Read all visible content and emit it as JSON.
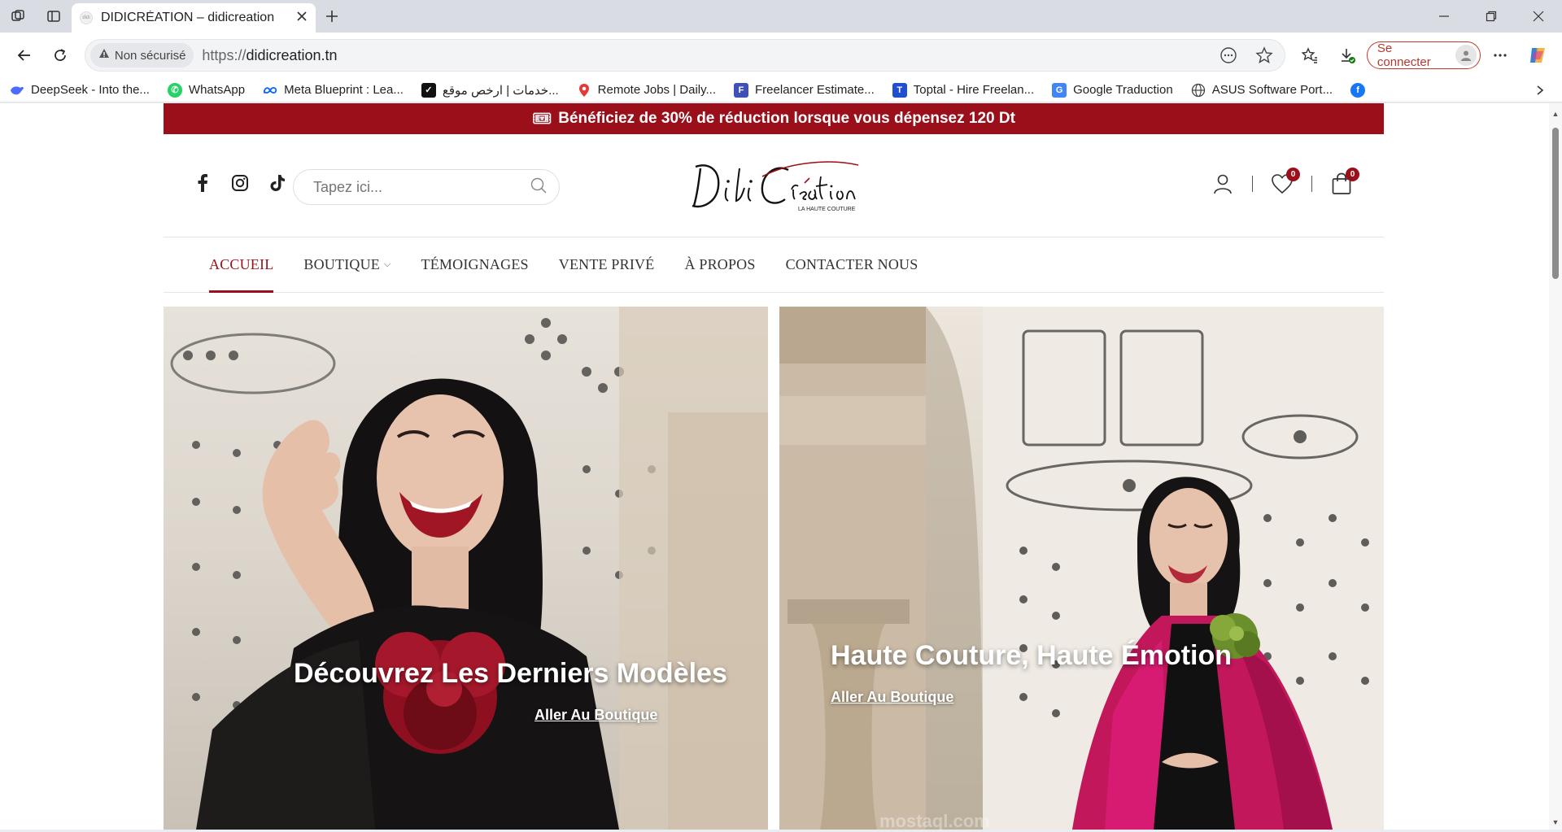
{
  "browser": {
    "tab_title": "DIDICRÉATION – didicreation",
    "favicon_text": "didi",
    "security_label": "Non sécurisé",
    "url_scheme": "https://",
    "url_host": "didicreation.tn",
    "signin_label": "Se connecter",
    "bookmarks": [
      {
        "label": "DeepSeek - Into the...",
        "icon": "deepseek-icon",
        "color": "#4d6bfe"
      },
      {
        "label": "WhatsApp",
        "icon": "whatsapp-icon",
        "color": "#25d366"
      },
      {
        "label": "Meta Blueprint : Lea...",
        "icon": "meta-icon",
        "color": "#0866ff"
      },
      {
        "label": "خدمات | ارخص موقع...",
        "icon": "khamsat-icon",
        "color": "#111111"
      },
      {
        "label": "Remote Jobs | Daily...",
        "icon": "location-pin-icon",
        "color": "#e53935"
      },
      {
        "label": "Freelancer Estimate...",
        "icon": "freelancer-icon",
        "color": "#3f51b5"
      },
      {
        "label": "Toptal - Hire Freelan...",
        "icon": "toptal-icon",
        "color": "#204ecf"
      },
      {
        "label": "Google Traduction",
        "icon": "google-translate-icon",
        "color": "#4285f4"
      },
      {
        "label": "ASUS Software Port...",
        "icon": "globe-icon",
        "color": "#444444"
      }
    ]
  },
  "site": {
    "promo_icon": "🎟",
    "promo_text": "Bénéficiez de 30% de réduction lorsque vous dépensez 120 Dt",
    "search_placeholder": "Tapez ici...",
    "logo": {
      "script": "Didi Création",
      "tagline": "LA HAUTE COUTURE"
    },
    "wishlist_count": "0",
    "cart_count": "0",
    "menu": [
      {
        "label": "ACCUEIL",
        "active": true
      },
      {
        "label": "BOUTIQUE",
        "active": false,
        "has_dropdown": true
      },
      {
        "label": "TÉMOIGNAGES",
        "active": false
      },
      {
        "label": "VENTE PRIVÉ",
        "active": false
      },
      {
        "label": "À PROPOS",
        "active": false
      },
      {
        "label": "CONTACTER NOUS",
        "active": false
      }
    ],
    "hero_left": {
      "headline": "Découvrez Les Derniers Modèles",
      "cta": "Aller Au Boutique"
    },
    "hero_right": {
      "headline": "Haute Couture, Haute Émotion",
      "cta": "Aller Au Boutique"
    },
    "watermark": "mostaql.com",
    "colors": {
      "brand": "#9b0f1a",
      "fuchsia_dress": "#c2185b",
      "burgundy_flower": "#8e1020"
    }
  }
}
